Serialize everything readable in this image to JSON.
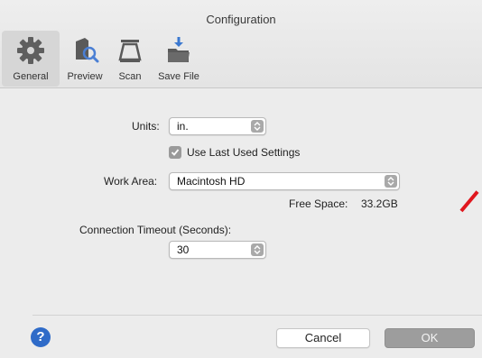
{
  "window": {
    "title": "Configuration"
  },
  "toolbar": {
    "items": [
      {
        "label": "General",
        "icon": "gear-icon",
        "selected": true
      },
      {
        "label": "Preview",
        "icon": "preview-icon",
        "selected": false
      },
      {
        "label": "Scan",
        "icon": "scan-icon",
        "selected": false
      },
      {
        "label": "Save File",
        "icon": "save-file-icon",
        "selected": false
      }
    ]
  },
  "general": {
    "units_label": "Units:",
    "units_value": "in.",
    "use_last_label": "Use Last Used Settings",
    "use_last_checked": true,
    "work_area_label": "Work Area:",
    "work_area_value": "Macintosh HD",
    "free_space_label": "Free Space:",
    "free_space_value": "33.2GB",
    "timeout_label": "Connection Timeout (Seconds):",
    "timeout_value": "30"
  },
  "footer": {
    "help_label": "?",
    "cancel_label": "Cancel",
    "ok_label": "OK"
  },
  "colors": {
    "help_blue": "#2f6bc8",
    "ok_disabled": "#9d9d9d",
    "annotation_red": "#e0171e"
  }
}
